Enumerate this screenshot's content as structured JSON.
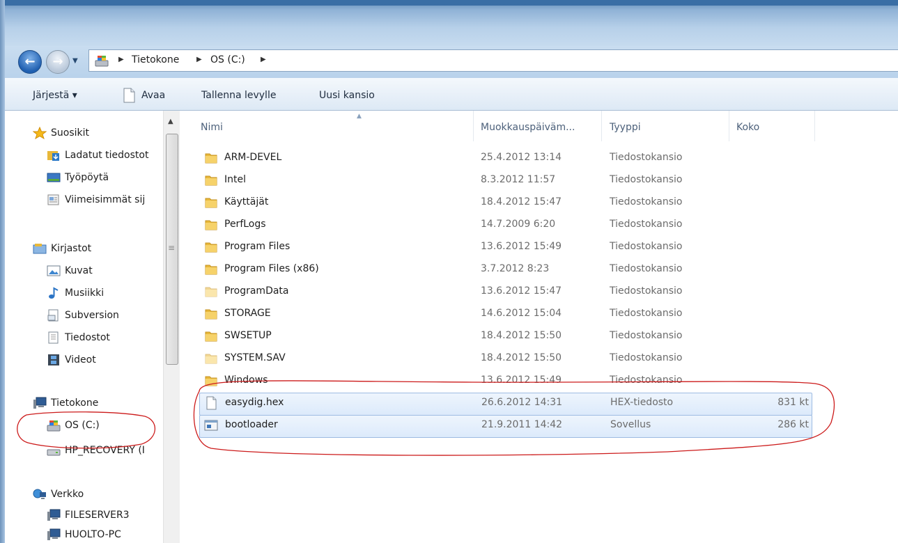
{
  "address": {
    "crumbs": [
      "Tietokone",
      "OS (C:)"
    ]
  },
  "toolbar": {
    "organize": "Järjestä ▾",
    "open": "Avaa",
    "burn": "Tallenna levylle",
    "new_folder": "Uusi kansio"
  },
  "nav": {
    "favorites": {
      "label": "Suosikit",
      "items": [
        "Ladatut tiedostot",
        "Työpöytä",
        "Viimeisimmät sij"
      ]
    },
    "libraries": {
      "label": "Kirjastot",
      "items": [
        "Kuvat",
        "Musiikki",
        "Subversion",
        "Tiedostot",
        "Videot"
      ]
    },
    "computer": {
      "label": "Tietokone",
      "items": [
        "OS (C:)",
        "HP_RECOVERY (I"
      ]
    },
    "network": {
      "label": "Verkko",
      "items": [
        "FILESERVER3",
        "HUOLTO-PC"
      ]
    }
  },
  "columns": {
    "name": "Nimi",
    "date": "Muokkauspäiväm...",
    "type": "Tyyppi",
    "size": "Koko"
  },
  "files": [
    {
      "name": "ARM-DEVEL",
      "date": "25.4.2012 13:14",
      "type": "Tiedostokansio",
      "size": "",
      "icon": "folder-icon"
    },
    {
      "name": "Intel",
      "date": "8.3.2012 11:57",
      "type": "Tiedostokansio",
      "size": "",
      "icon": "folder-icon"
    },
    {
      "name": "Käyttäjät",
      "date": "18.4.2012 15:47",
      "type": "Tiedostokansio",
      "size": "",
      "icon": "folder-icon"
    },
    {
      "name": "PerfLogs",
      "date": "14.7.2009 6:20",
      "type": "Tiedostokansio",
      "size": "",
      "icon": "folder-icon"
    },
    {
      "name": "Program Files",
      "date": "13.6.2012 15:49",
      "type": "Tiedostokansio",
      "size": "",
      "icon": "folder-icon"
    },
    {
      "name": "Program Files (x86)",
      "date": "3.7.2012 8:23",
      "type": "Tiedostokansio",
      "size": "",
      "icon": "folder-icon"
    },
    {
      "name": "ProgramData",
      "date": "13.6.2012 15:47",
      "type": "Tiedostokansio",
      "size": "",
      "icon": "hidden-folder-icon"
    },
    {
      "name": "STORAGE",
      "date": "14.6.2012 15:04",
      "type": "Tiedostokansio",
      "size": "",
      "icon": "folder-icon"
    },
    {
      "name": "SWSETUP",
      "date": "18.4.2012 15:50",
      "type": "Tiedostokansio",
      "size": "",
      "icon": "folder-icon"
    },
    {
      "name": "SYSTEM.SAV",
      "date": "18.4.2012 15:50",
      "type": "Tiedostokansio",
      "size": "",
      "icon": "hidden-folder-icon"
    },
    {
      "name": "Windows",
      "date": "13.6.2012 15:49",
      "type": "Tiedostokansio",
      "size": "",
      "icon": "folder-icon"
    },
    {
      "name": "easydig.hex",
      "date": "26.6.2012 14:31",
      "type": "HEX-tiedosto",
      "size": "831 kt",
      "icon": "document-icon",
      "selected": true
    },
    {
      "name": "bootloader",
      "date": "21.9.2011 14:42",
      "type": "Sovellus",
      "size": "286 kt",
      "icon": "application-icon",
      "selected": true
    }
  ],
  "colors": {
    "annotation": "#cc1a1a",
    "selection_border": "#9dbbe2",
    "folder": "#e8b83a"
  }
}
